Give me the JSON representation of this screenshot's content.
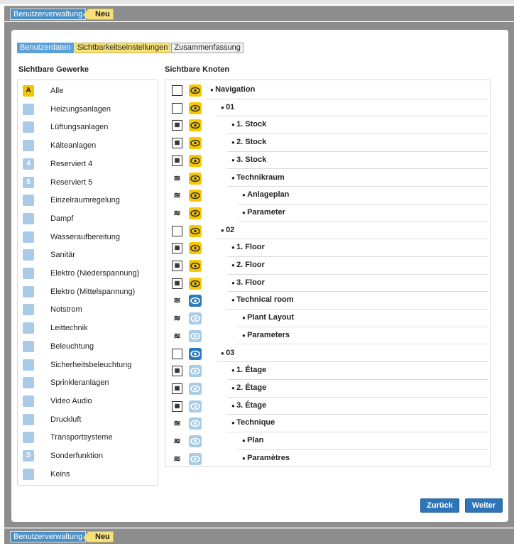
{
  "app": {
    "breadcrumb": "Benutzerverwaltung",
    "badge": "Neu"
  },
  "wizard": {
    "steps": [
      "Benutzerdaten",
      "Sichtbarkeitseinstellungen",
      "Zusammenfassung"
    ],
    "active": 1
  },
  "left": {
    "heading": "Sichtbare Gewerke",
    "items": [
      {
        "label": "Alle",
        "icon": "A",
        "selected": true
      },
      {
        "label": "Heizungsanlagen",
        "icon": "heating-icon"
      },
      {
        "label": "Lüftungsanlagen",
        "icon": "ventilation-icon"
      },
      {
        "label": "Kälteanlagen",
        "icon": "snowflake-icon"
      },
      {
        "label": "Reserviert 4",
        "icon": "4"
      },
      {
        "label": "Reserviert 5",
        "icon": "5"
      },
      {
        "label": "Einzelraumregelung",
        "icon": "room-control-icon"
      },
      {
        "label": "Dampf",
        "icon": "steam-icon"
      },
      {
        "label": "Wasseraufbereitung",
        "icon": "water-icon"
      },
      {
        "label": "Sanitär",
        "icon": "sanitary-icon"
      },
      {
        "label": "Elektro (Niederspannung)",
        "icon": "low-voltage-icon"
      },
      {
        "label": "Elektro (Mittelspannung)",
        "icon": "medium-voltage-icon"
      },
      {
        "label": "Notstrom",
        "icon": "emergency-power-icon"
      },
      {
        "label": "Leittechnik",
        "icon": "control-icon"
      },
      {
        "label": "Beleuchtung",
        "icon": "light-icon"
      },
      {
        "label": "Sicherheitsbeleuchtung",
        "icon": "emergency-light-icon"
      },
      {
        "label": "Sprinkleranlagen",
        "icon": "sprinkler-icon"
      },
      {
        "label": "Video Audio",
        "icon": "video-icon"
      },
      {
        "label": "Druckluft",
        "icon": "compressed-air-icon"
      },
      {
        "label": "Transportsysteme",
        "icon": "transport-icon"
      },
      {
        "label": "Sonderfunktion",
        "icon": "S"
      },
      {
        "label": "Keins",
        "icon": "none-icon"
      }
    ]
  },
  "right": {
    "heading": "Sichtbare Knoten",
    "nodes": [
      {
        "label": "Navigation",
        "level": 0,
        "type": "checkbox",
        "eye": "yellow"
      },
      {
        "label": "01",
        "level": 1,
        "type": "checkbox",
        "eye": "yellow"
      },
      {
        "label": "1. Stock",
        "level": 2,
        "type": "room",
        "eye": "yellow"
      },
      {
        "label": "2. Stock",
        "level": 2,
        "type": "room",
        "eye": "yellow"
      },
      {
        "label": "3. Stock",
        "level": 2,
        "type": "room",
        "eye": "yellow"
      },
      {
        "label": "Technikraum",
        "level": 2,
        "type": "heating",
        "eye": "yellow"
      },
      {
        "label": "Anlageplan",
        "level": 3,
        "type": "heating",
        "eye": "yellow"
      },
      {
        "label": "Parameter",
        "level": 3,
        "type": "heating",
        "eye": "yellow"
      },
      {
        "label": "02",
        "level": 1,
        "type": "checkbox",
        "eye": "yellow"
      },
      {
        "label": "1. Floor",
        "level": 2,
        "type": "room",
        "eye": "yellow"
      },
      {
        "label": "2. Floor",
        "level": 2,
        "type": "room",
        "eye": "yellow"
      },
      {
        "label": "3. Floor",
        "level": 2,
        "type": "room",
        "eye": "yellow"
      },
      {
        "label": "Technical room",
        "level": 2,
        "type": "heating",
        "eye": "blue"
      },
      {
        "label": "Plant Layout",
        "level": 3,
        "type": "heating",
        "eye": "light"
      },
      {
        "label": "Parameters",
        "level": 3,
        "type": "heating",
        "eye": "light"
      },
      {
        "label": "03",
        "level": 1,
        "type": "checkbox",
        "eye": "blue"
      },
      {
        "label": "1. Étage",
        "level": 2,
        "type": "room",
        "eye": "light"
      },
      {
        "label": "2. Étage",
        "level": 2,
        "type": "room",
        "eye": "light"
      },
      {
        "label": "3. Étage",
        "level": 2,
        "type": "room",
        "eye": "light"
      },
      {
        "label": "Technique",
        "level": 2,
        "type": "heating",
        "eye": "light"
      },
      {
        "label": "Plan",
        "level": 3,
        "type": "heating",
        "eye": "light"
      },
      {
        "label": "Paramètres",
        "level": 3,
        "type": "heating",
        "eye": "light"
      }
    ]
  },
  "buttons": {
    "back": "Zurück",
    "next": "Weiter"
  },
  "colors": {
    "accent": "#2d74b8",
    "highlight": "#f7c800",
    "iconBlue": "#a9cbe8"
  }
}
